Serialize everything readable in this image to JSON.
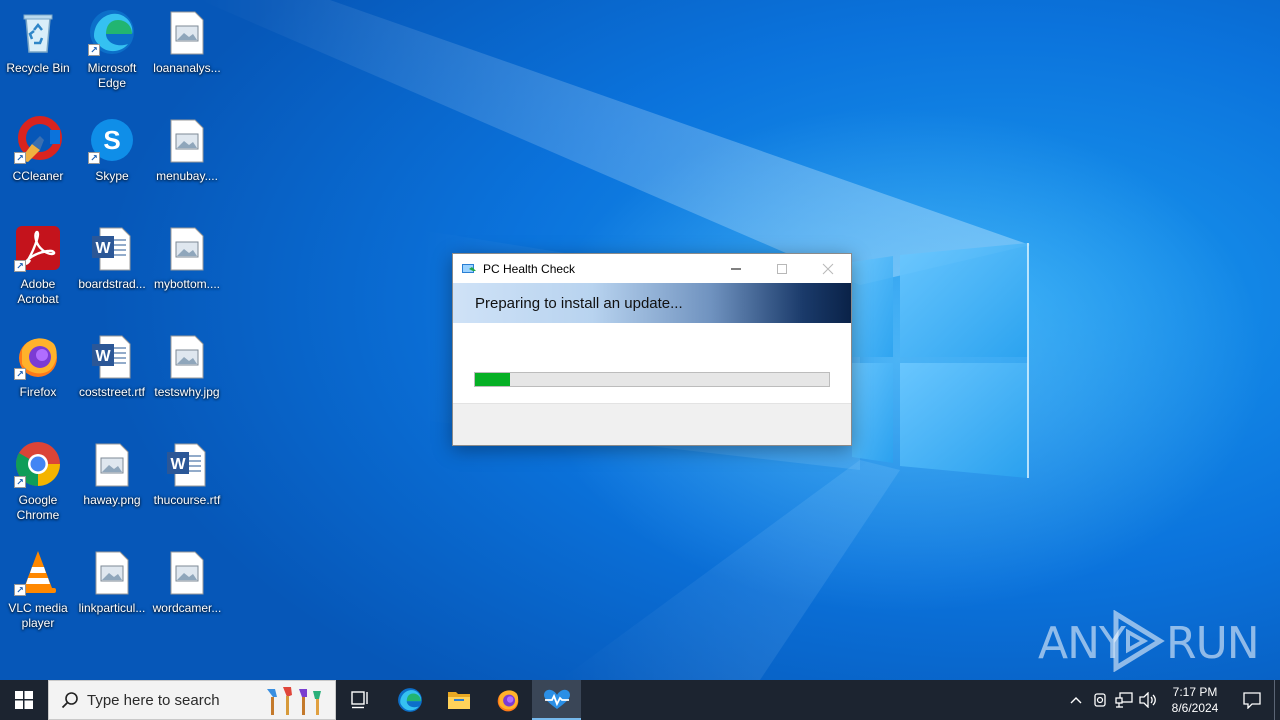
{
  "desktop": {
    "icons": [
      {
        "label": "Recycle Bin",
        "icon": "recycle-bin-icon",
        "shortcut": false
      },
      {
        "label": "Microsoft Edge",
        "icon": "edge-icon",
        "shortcut": true
      },
      {
        "label": "loananalys...",
        "icon": "image-file-icon",
        "shortcut": false
      },
      {
        "label": "CCleaner",
        "icon": "ccleaner-icon",
        "shortcut": true
      },
      {
        "label": "Skype",
        "icon": "skype-icon",
        "shortcut": true
      },
      {
        "label": "menubay....",
        "icon": "image-file-icon",
        "shortcut": false
      },
      {
        "label": "Adobe Acrobat",
        "icon": "acrobat-icon",
        "shortcut": true
      },
      {
        "label": "boardstrad...",
        "icon": "word-doc-icon",
        "shortcut": false
      },
      {
        "label": "mybottom....",
        "icon": "image-file-icon",
        "shortcut": false
      },
      {
        "label": "Firefox",
        "icon": "firefox-icon",
        "shortcut": true
      },
      {
        "label": "coststreet.rtf",
        "icon": "word-doc-icon",
        "shortcut": false
      },
      {
        "label": "testswhy.jpg",
        "icon": "image-file-icon",
        "shortcut": false
      },
      {
        "label": "Google Chrome",
        "icon": "chrome-icon",
        "shortcut": true
      },
      {
        "label": "haway.png",
        "icon": "image-file-icon",
        "shortcut": false
      },
      {
        "label": "thucourse.rtf",
        "icon": "word-doc-icon",
        "shortcut": false
      },
      {
        "label": "VLC media player",
        "icon": "vlc-icon",
        "shortcut": true
      },
      {
        "label": "linkparticul...",
        "icon": "image-file-icon",
        "shortcut": false
      },
      {
        "label": "wordcamer...",
        "icon": "image-file-icon",
        "shortcut": false
      }
    ]
  },
  "dialog": {
    "title": "PC Health Check",
    "banner_text": "Preparing to install an update...",
    "progress": 0.1,
    "progress_color": "#06b025"
  },
  "watermark": {
    "text_left": "ANY",
    "text_right": "RUN"
  },
  "taskbar": {
    "search_placeholder": "Type here to search",
    "pinned": [
      "task-view-icon",
      "edge-icon",
      "file-explorer-icon",
      "firefox-icon",
      "pc-health-check-icon"
    ],
    "active": "pc-health-check-icon",
    "clock_time": "7:17 PM",
    "clock_date": "8/6/2024"
  },
  "colors": {
    "desktop_blue": "#0b73dc",
    "taskbar": "#1c2430",
    "accent": "#76b9ed"
  }
}
